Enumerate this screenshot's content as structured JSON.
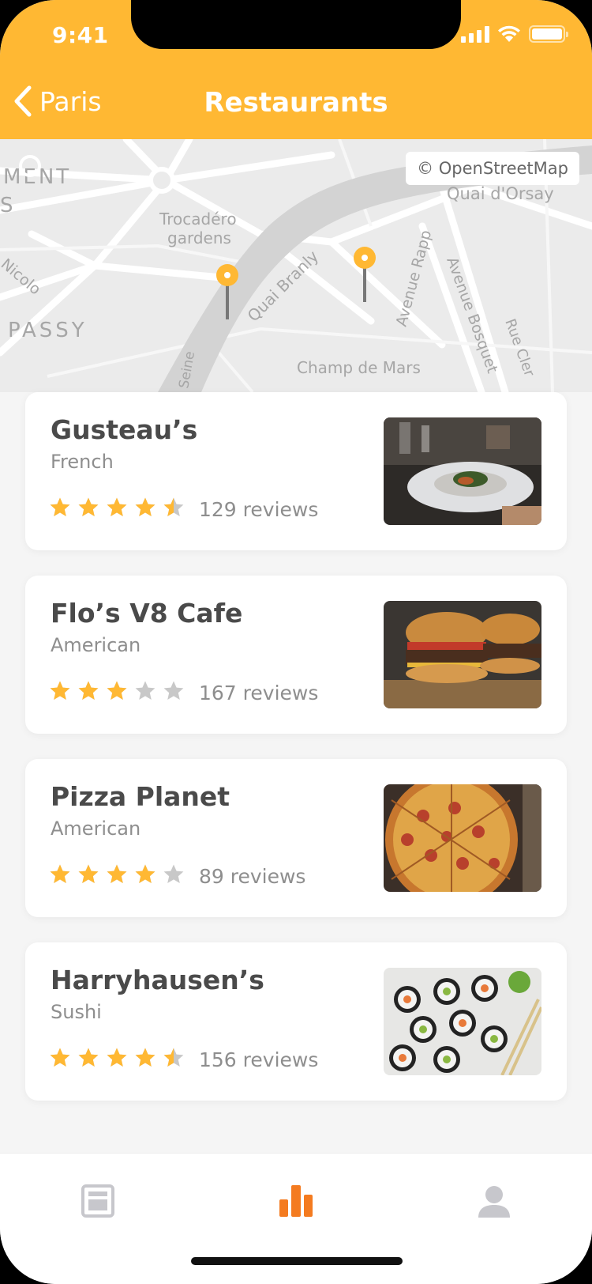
{
  "status": {
    "time": "9:41"
  },
  "nav": {
    "back_label": "Paris",
    "title": "Restaurants"
  },
  "map": {
    "attribution": "© OpenStreetMap",
    "labels": {
      "ment": "MENT",
      "s": "S",
      "trocadero_1": "Trocadéro",
      "trocadero_2": "gardens",
      "quai_orsay": "Quai d'Orsay",
      "nicolo": "Nicolo",
      "passy": "PASSY",
      "quai_branly": "Quai Branly",
      "avenue_rapp": "Avenue Rapp",
      "avenue_bosquet": "Avenue Bosquet",
      "rue_cler": "Rue Cler",
      "champ_de_mars": "Champ de Mars",
      "seine": "Seine"
    },
    "pin_color": "#ffb833"
  },
  "restaurants": [
    {
      "name": "Gusteau’s",
      "cuisine": "French",
      "rating": 4.5,
      "reviews": "129 reviews",
      "image": "plated-dish"
    },
    {
      "name": "Flo’s V8 Cafe",
      "cuisine": "American",
      "rating": 3,
      "reviews": "167 reviews",
      "image": "burgers"
    },
    {
      "name": "Pizza Planet",
      "cuisine": "American",
      "rating": 4,
      "reviews": "89 reviews",
      "image": "pizza"
    },
    {
      "name": "Harryhausen’s",
      "cuisine": "Sushi",
      "rating": 4.5,
      "reviews": "156 reviews",
      "image": "sushi"
    }
  ],
  "tabs": [
    {
      "icon": "newspaper-icon",
      "active": false
    },
    {
      "icon": "chart-icon",
      "active": true
    },
    {
      "icon": "person-icon",
      "active": false
    }
  ],
  "colors": {
    "accent": "#ffb833",
    "active_tab": "#f47b20",
    "inactive_tab": "#c7c7cc",
    "star_on": "#ffb833",
    "star_off": "#c8c8c8"
  }
}
